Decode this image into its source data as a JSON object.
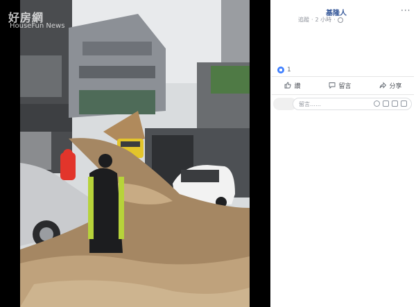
{
  "watermark": {
    "title": "好房網",
    "subtitle": "HouseFun News"
  },
  "post": {
    "page_name": "基隆人",
    "timestamp": "2 小時",
    "edited": "追蹤",
    "more_label": "···",
    "reaction_count": "1"
  },
  "actions": {
    "like": "讚",
    "comment": "留言",
    "share": "分享"
  },
  "comment_box": {
    "placeholder": "留言……"
  },
  "colors": {
    "link": "#365899",
    "like": "#4080ff",
    "viewer_bg": "#000000"
  }
}
